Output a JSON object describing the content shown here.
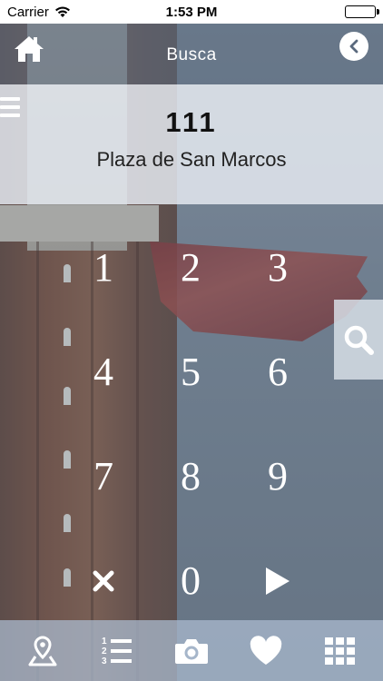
{
  "status_bar": {
    "carrier": "Carrier",
    "time": "1:53 PM"
  },
  "navbar": {
    "title": "Busca",
    "home_icon": "home-icon",
    "back_icon": "chevron-left-icon"
  },
  "result": {
    "code": "111",
    "name": "Plaza de San Marcos"
  },
  "keypad": {
    "keys": [
      {
        "label": "1",
        "name": "key-1"
      },
      {
        "label": "2",
        "name": "key-2"
      },
      {
        "label": "3",
        "name": "key-3"
      },
      {
        "label": "4",
        "name": "key-4"
      },
      {
        "label": "5",
        "name": "key-5"
      },
      {
        "label": "6",
        "name": "key-6"
      },
      {
        "label": "7",
        "name": "key-7"
      },
      {
        "label": "8",
        "name": "key-8"
      },
      {
        "label": "9",
        "name": "key-9"
      },
      {
        "label": "✖",
        "name": "key-clear"
      },
      {
        "label": "0",
        "name": "key-0"
      },
      {
        "label": "▶",
        "name": "key-go"
      }
    ]
  },
  "tabbar": {
    "items": [
      "map-pin-icon",
      "numbered-list-icon",
      "camera-icon",
      "heart-icon",
      "grid-icon"
    ]
  },
  "colors": {
    "panel": "#e4e9f0",
    "bar": "#5a697d",
    "text_light": "#ffffff"
  }
}
